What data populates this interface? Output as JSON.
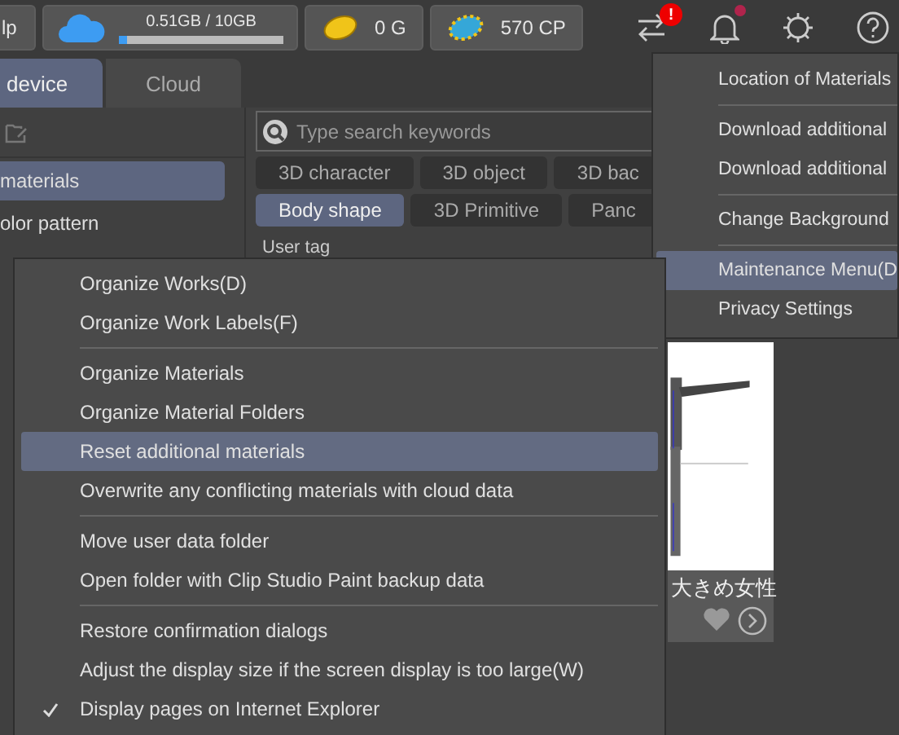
{
  "top_bar": {
    "partial_button": "lp",
    "storage": {
      "text": "0.51GB / 10GB",
      "level": 0.05
    },
    "gold": "0 G",
    "cp": "570 CP",
    "sync_badge": "!",
    "notification_unread": true
  },
  "tabs": [
    {
      "label": "device",
      "selected": true
    },
    {
      "label": "Cloud",
      "selected": false
    }
  ],
  "sidebar": {
    "items": [
      {
        "label": "materials",
        "selected": true
      },
      {
        "label": "olor pattern",
        "selected": false
      }
    ]
  },
  "search": {
    "placeholder": "Type search keywords"
  },
  "tag_rows": [
    [
      {
        "label": "3D character",
        "selected": false
      },
      {
        "label": "3D object",
        "selected": false
      },
      {
        "label": "3D bac",
        "selected": false
      }
    ],
    [
      {
        "label": "Body shape",
        "selected": true
      },
      {
        "label": "3D Primitive",
        "selected": false
      },
      {
        "label": "Panc",
        "selected": false
      }
    ]
  ],
  "user_tag": "User tag",
  "card": {
    "kind": "picture",
    "caption": "大きめ女性"
  },
  "main_menu": [
    {
      "kind": "item",
      "label": "Location of Materials",
      "selected": false
    },
    {
      "kind": "separator"
    },
    {
      "kind": "item",
      "label": "Download additional",
      "selected": false
    },
    {
      "kind": "item",
      "label": "Download additional",
      "selected": false
    },
    {
      "kind": "separator"
    },
    {
      "kind": "item",
      "label": "Change Background",
      "selected": false
    },
    {
      "kind": "separator"
    },
    {
      "kind": "item",
      "label": "Maintenance Menu(D",
      "selected": true
    },
    {
      "kind": "item",
      "label": "Privacy Settings",
      "selected": false
    }
  ],
  "submenu": [
    {
      "kind": "item",
      "label": "Organize Works(D)",
      "selected": false,
      "checked": false
    },
    {
      "kind": "item",
      "label": "Organize Work Labels(F)",
      "selected": false,
      "checked": false
    },
    {
      "kind": "separator"
    },
    {
      "kind": "item",
      "label": "Organize Materials",
      "selected": false,
      "checked": false
    },
    {
      "kind": "item",
      "label": "Organize Material Folders",
      "selected": false,
      "checked": false
    },
    {
      "kind": "item",
      "label": "Reset additional materials",
      "selected": true,
      "checked": false
    },
    {
      "kind": "item",
      "label": "Overwrite any conflicting materials with cloud data",
      "selected": false,
      "checked": false
    },
    {
      "kind": "separator"
    },
    {
      "kind": "item",
      "label": "Move user data folder",
      "selected": false,
      "checked": false
    },
    {
      "kind": "item",
      "label": "Open folder with Clip Studio Paint backup data",
      "selected": false,
      "checked": false
    },
    {
      "kind": "separator"
    },
    {
      "kind": "item",
      "label": "Restore confirmation dialogs",
      "selected": false,
      "checked": false
    },
    {
      "kind": "item",
      "label": "Adjust the display size if the screen display is too large(W)",
      "selected": false,
      "checked": false
    },
    {
      "kind": "item",
      "label": "Display pages on Internet Explorer",
      "selected": false,
      "checked": true
    }
  ]
}
